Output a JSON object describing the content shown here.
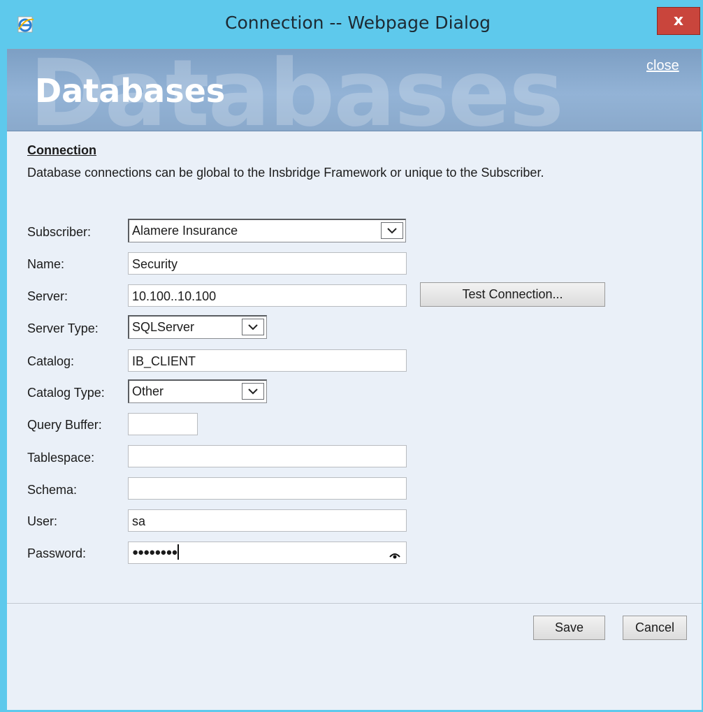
{
  "window": {
    "title": "Connection -- Webpage Dialog",
    "close_glyph": "x",
    "icon": "ie-icon"
  },
  "banner": {
    "title": "Databases",
    "watermark": "Databases",
    "close_link": "close"
  },
  "section": {
    "heading": "Connection",
    "description": "Database connections can be global to the Insbridge Framework or unique to the Subscriber."
  },
  "form": {
    "subscriber": {
      "label": "Subscriber:",
      "value": "Alamere Insurance"
    },
    "name": {
      "label": "Name:",
      "value": "Security"
    },
    "server": {
      "label": "Server:",
      "value": "10.100..10.100"
    },
    "server_type": {
      "label": "Server Type:",
      "value": "SQLServer"
    },
    "catalog": {
      "label": "Catalog:",
      "value": "IB_CLIENT"
    },
    "catalog_type": {
      "label": "Catalog Type:",
      "value": "Other"
    },
    "query_buffer": {
      "label": "Query Buffer:",
      "value": ""
    },
    "tablespace": {
      "label": "Tablespace:",
      "value": ""
    },
    "schema": {
      "label": "Schema:",
      "value": ""
    },
    "user": {
      "label": "User:",
      "value": "sa"
    },
    "password": {
      "label": "Password:",
      "value": "●●●●●●●●"
    }
  },
  "buttons": {
    "test_connection": "Test Connection...",
    "save": "Save",
    "cancel": "Cancel"
  },
  "colors": {
    "titlebar": "#5ec9ec",
    "close_button": "#c9453c",
    "banner": "#8aa9cb",
    "client_bg": "#eaf0f8"
  }
}
